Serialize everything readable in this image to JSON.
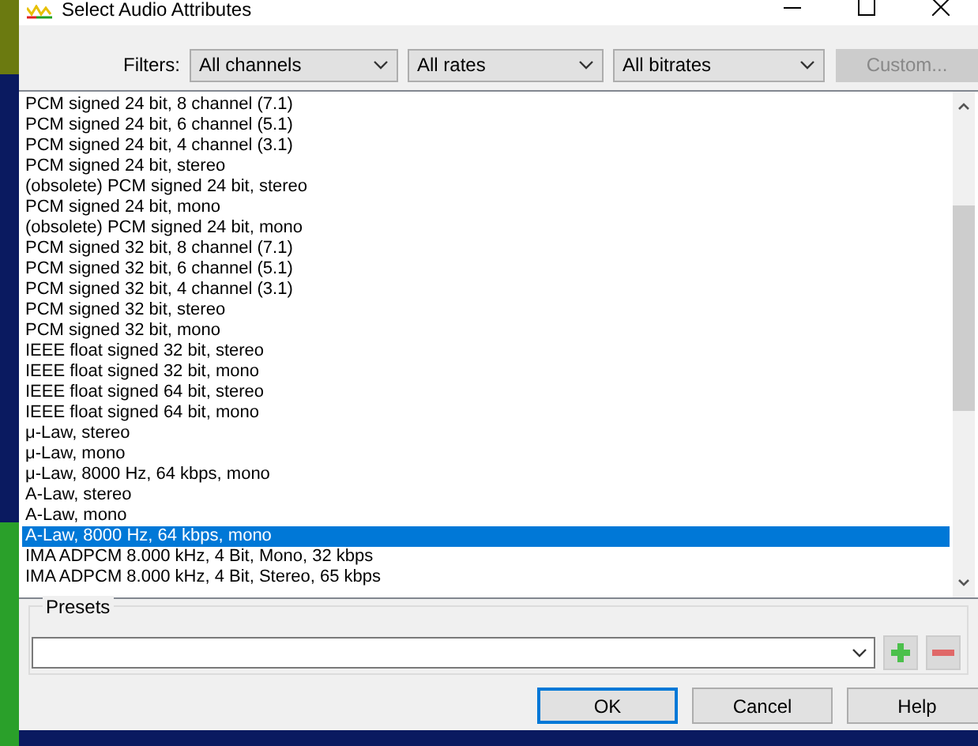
{
  "window": {
    "title": "Select Audio Attributes"
  },
  "filters": {
    "label": "Filters:",
    "dropdowns": [
      {
        "value": "All channels"
      },
      {
        "value": "All rates"
      },
      {
        "value": "All bitrates"
      }
    ],
    "custom_button": {
      "label": "Custom...",
      "disabled": true
    }
  },
  "formats": [
    {
      "label": "PCM signed 24 bit, 8 channel (7.1)",
      "selected": false
    },
    {
      "label": "PCM signed 24 bit, 6 channel (5.1)",
      "selected": false
    },
    {
      "label": "PCM signed 24 bit, 4 channel (3.1)",
      "selected": false
    },
    {
      "label": "PCM signed 24 bit, stereo",
      "selected": false
    },
    {
      "label": "(obsolete) PCM signed 24 bit, stereo",
      "selected": false
    },
    {
      "label": "PCM signed 24 bit, mono",
      "selected": false
    },
    {
      "label": "(obsolete) PCM signed 24 bit, mono",
      "selected": false
    },
    {
      "label": "PCM signed 32 bit, 8 channel (7.1)",
      "selected": false
    },
    {
      "label": "PCM signed 32 bit, 6 channel (5.1)",
      "selected": false
    },
    {
      "label": "PCM signed 32 bit, 4 channel (3.1)",
      "selected": false
    },
    {
      "label": "PCM signed 32 bit, stereo",
      "selected": false
    },
    {
      "label": "PCM signed 32 bit, mono",
      "selected": false
    },
    {
      "label": "IEEE float signed 32 bit, stereo",
      "selected": false
    },
    {
      "label": "IEEE float signed 32 bit, mono",
      "selected": false
    },
    {
      "label": "IEEE float signed 64 bit, stereo",
      "selected": false
    },
    {
      "label": "IEEE float signed 64 bit, mono",
      "selected": false
    },
    {
      "label": "μ-Law, stereo",
      "selected": false
    },
    {
      "label": "μ-Law, mono",
      "selected": false
    },
    {
      "label": "μ-Law, 8000 Hz, 64 kbps, mono",
      "selected": false
    },
    {
      "label": "A-Law, stereo",
      "selected": false
    },
    {
      "label": "A-Law, mono",
      "selected": false
    },
    {
      "label": "A-Law, 8000 Hz, 64 kbps, mono",
      "selected": true
    },
    {
      "label": "IMA ADPCM 8.000 kHz, 4 Bit, Mono, 32 kbps",
      "selected": false
    },
    {
      "label": "IMA ADPCM 8.000 kHz, 4 Bit, Stereo, 65 kbps",
      "selected": false
    }
  ],
  "presets": {
    "label": "Presets"
  },
  "buttons": [
    {
      "label": "OK",
      "default": true
    },
    {
      "label": "Cancel",
      "default": false
    },
    {
      "label": "Help",
      "default": false
    }
  ]
}
